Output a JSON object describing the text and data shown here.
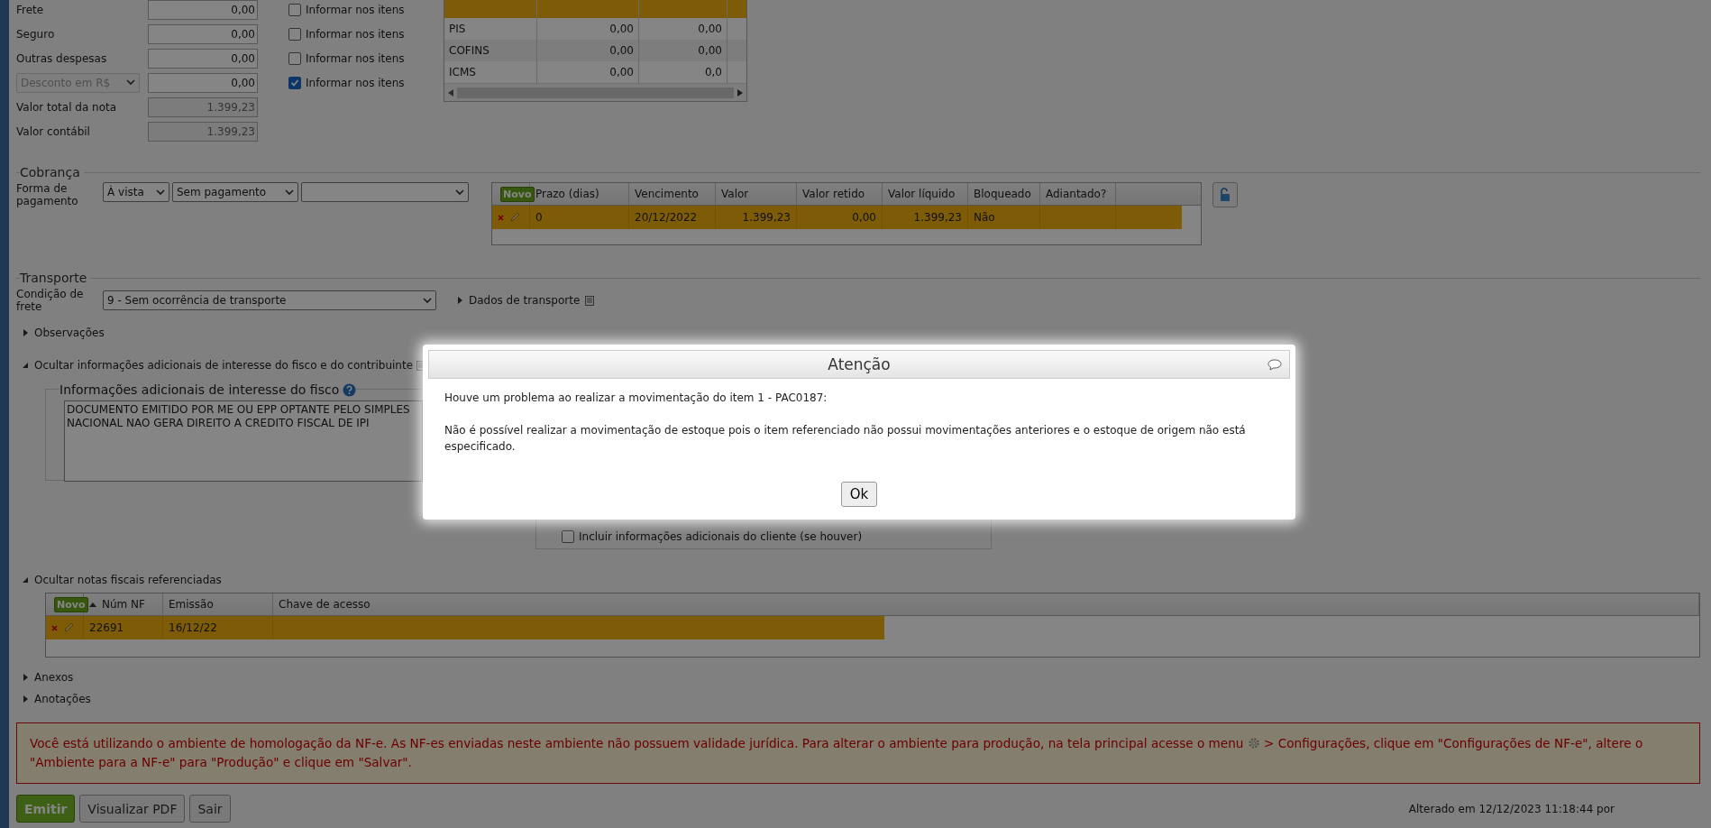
{
  "totals": {
    "rows": [
      {
        "kind": "field",
        "label": "Frete",
        "value": "0,00",
        "informar": {
          "label": "Informar nos itens",
          "checked": false
        }
      },
      {
        "kind": "field",
        "label": "Seguro",
        "value": "0,00",
        "informar": {
          "label": "Informar nos itens",
          "checked": false
        }
      },
      {
        "kind": "field",
        "label": "Outras despesas",
        "value": "0,00",
        "informar": {
          "label": "Informar nos itens",
          "checked": false
        }
      },
      {
        "kind": "select",
        "label": "Desconto em R$",
        "value": "0,00",
        "disabled": true,
        "informar": {
          "label": "Informar nos itens",
          "checked": true
        }
      },
      {
        "kind": "readonly",
        "label": "Valor total da nota",
        "value": "1.399,23"
      },
      {
        "kind": "readonly",
        "label": "Valor contábil",
        "value": "1.399,23"
      }
    ]
  },
  "tax_table": {
    "rows": [
      {
        "selected": true
      },
      {
        "selected": false,
        "tax": "PIS",
        "col_2": "0,00",
        "col_3": "0,00"
      },
      {
        "selected": false,
        "tax": "COFINS",
        "col_2": "0,00",
        "col_3": "0,00"
      },
      {
        "selected": false,
        "tax": "ICMS",
        "col_2": "0,00",
        "col_3": "0,0"
      }
    ]
  },
  "cobranca": {
    "title": "Cobrança",
    "payment_label": "Forma de pagamento",
    "selects": [
      {
        "kind": "select",
        "value": "À vista"
      },
      {
        "kind": "select",
        "value": "Sem pagamento"
      },
      {
        "kind": "select"
      }
    ],
    "grid": {
      "new_button": "Novo",
      "columns": [
        "Prazo (dias)",
        "Vencimento",
        "Valor",
        "Valor retido",
        "Valor líquido",
        "Bloqueado",
        "Adiantado?"
      ],
      "rows": [
        {
          "selected": true,
          "cells": [
            "0",
            "20/12/2022",
            "1.399,23",
            "0,00",
            "1.399,23",
            "Não",
            null
          ]
        }
      ]
    }
  },
  "transporte": {
    "title": "Transporte",
    "label": "Condição de frete",
    "value": "9 - Sem ocorrência de transporte",
    "link": "Dados de transporte"
  },
  "sections": [
    {
      "label": "Observações",
      "expanded": false
    },
    {
      "label": "Ocultar informações adicionais de interesse do fisco e do contribuinte",
      "expanded": true
    }
  ],
  "fisco": {
    "legend": "Informações adicionais de interesse do fisco",
    "text": "DOCUMENTO EMITIDO POR ME OU EPP OPTANTE PELO SIMPLES NACIONAL NAO GERA DIREITO A CREDITO FISCAL DE IPI"
  },
  "contribuinte": {
    "include_client": {
      "label": "Incluir informações adicionais do cliente (se houver)",
      "checked": false
    }
  },
  "referenced": {
    "label": "Ocultar notas fiscais referenciadas",
    "expanded": true,
    "new_button": "Novo",
    "columns": [
      {
        "label": "Núm NF",
        "sorted": true
      },
      {
        "label": "Emissão",
        "sorted": false
      },
      {
        "label": "Chave de acesso",
        "sorted": false
      }
    ],
    "rows": [
      {
        "selected": true,
        "cells": [
          "22691",
          "16/12/22"
        ]
      }
    ]
  },
  "more_sections": [
    {
      "label": "Anexos",
      "expanded": false
    },
    {
      "label": "Anotações",
      "expanded": false
    }
  ],
  "warning": {
    "text_before": "Você está utilizando o ambiente de homologação da NF-e. As NF-es enviadas neste ambiente não possuem validade jurídica. Para alterar o ambiente para produção, na tela principal acesse o menu",
    "text_after": "> Configurações, clique em \"Configurações de NF-e\", altere o \"Ambiente para a NF-e\" para \"Produção\" e clique em \"Salvar\"."
  },
  "buttons": [
    {
      "label": "Emitir",
      "kind": "primary"
    },
    {
      "label": "Visualizar PDF",
      "kind": "default"
    },
    {
      "label": "Sair",
      "kind": "default"
    }
  ],
  "modified": "Alterado em 12/12/2023 11:18:44 por",
  "dialog": {
    "title": "Atenção",
    "paragraphs": [
      "Houve um problema ao realizar a movimentação do item 1 - PAC0187:",
      "Não é possível realizar a movimentação de estoque pois o item referenciado não possui movimentações anteriores e o estoque de origem não está especificado."
    ],
    "ok": "Ok"
  }
}
